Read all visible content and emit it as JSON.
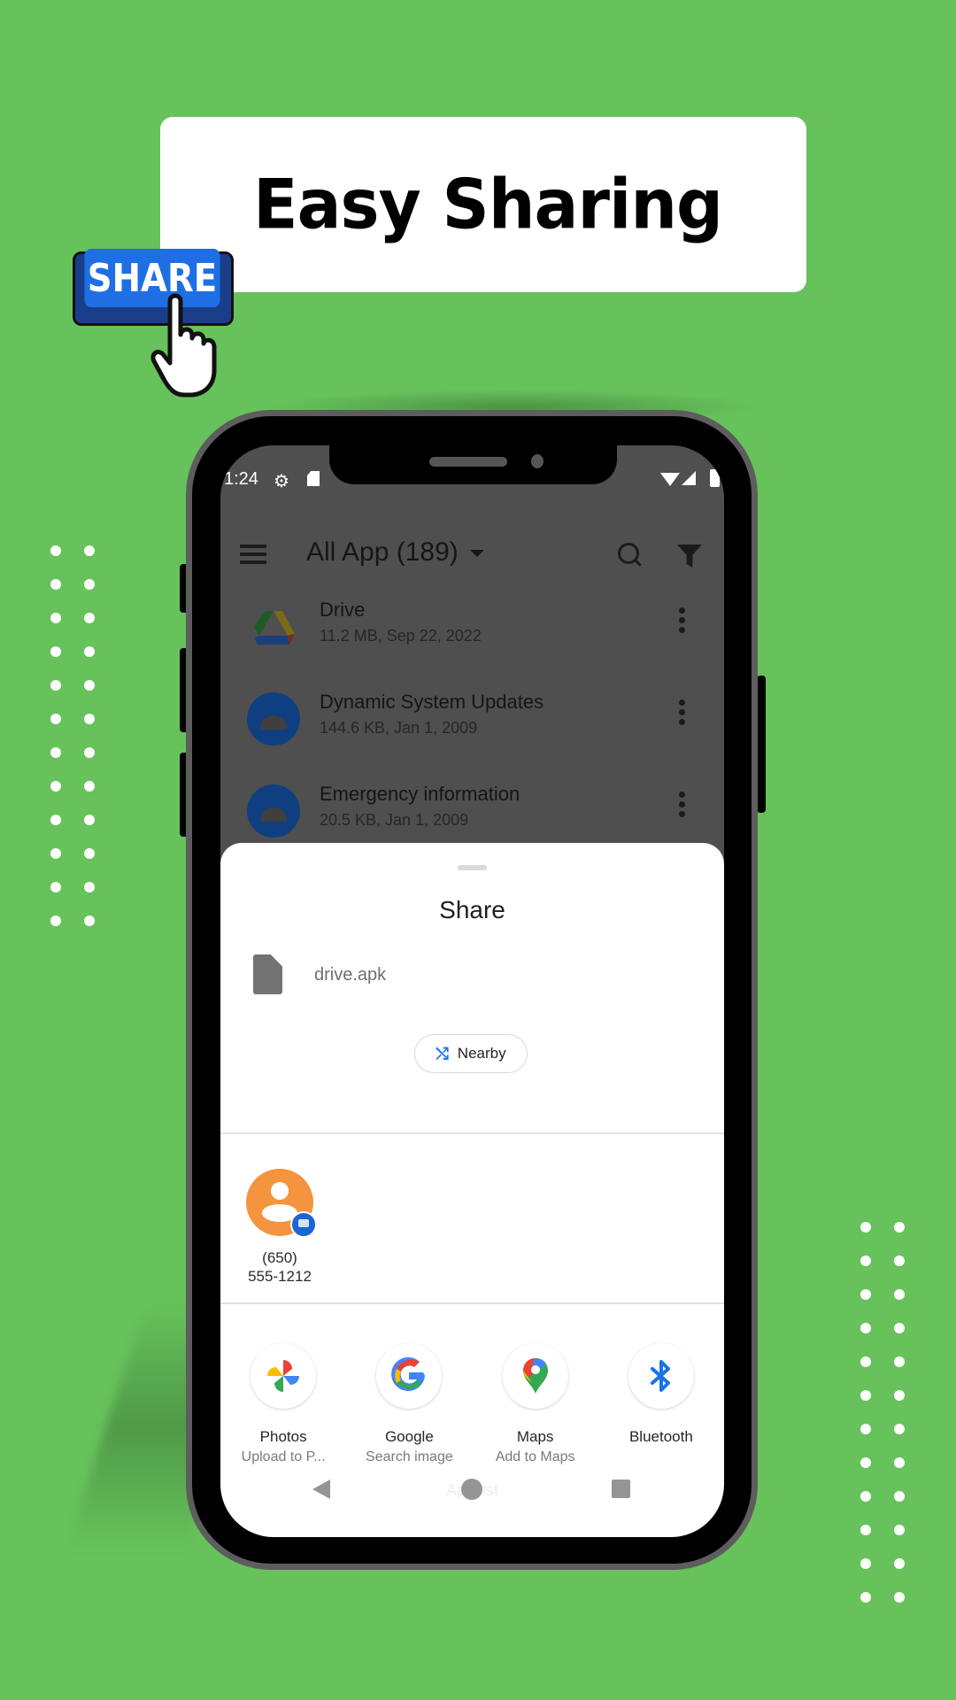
{
  "headline": "Easy Sharing",
  "share_badge": "SHARE",
  "status_bar": {
    "time": "1:24"
  },
  "app_bar": {
    "title": "All App (189)"
  },
  "app_list": [
    {
      "name": "Drive",
      "meta": "11.2 MB, Sep 22, 2022",
      "icon": "google-drive-icon"
    },
    {
      "name": "Dynamic System Updates",
      "meta": "144.6 KB, Jan 1, 2009",
      "icon": "android-icon"
    },
    {
      "name": "Emergency information",
      "meta": "20.5 KB, Jan 1, 2009",
      "icon": "android-icon"
    }
  ],
  "share_sheet": {
    "title": "Share",
    "file_name": "drive.apk",
    "nearby_label": "Nearby",
    "contact": {
      "line1": "(650)",
      "line2": "555-1212"
    },
    "targets": [
      {
        "name": "Photos",
        "sub": "Upload to P...",
        "icon": "google-photos-icon"
      },
      {
        "name": "Google",
        "sub": "Search image",
        "icon": "google-icon"
      },
      {
        "name": "Maps",
        "sub": "Add to Maps",
        "icon": "google-maps-icon"
      },
      {
        "name": "Bluetooth",
        "sub": "",
        "icon": "bluetooth-icon"
      }
    ]
  },
  "nav_bar": {
    "ghost_label": "App list"
  },
  "colors": {
    "background": "#67c25b",
    "accent_blue": "#1a73e8",
    "badge_blue": "#1e6fe3",
    "contact_orange": "#f5943e"
  }
}
